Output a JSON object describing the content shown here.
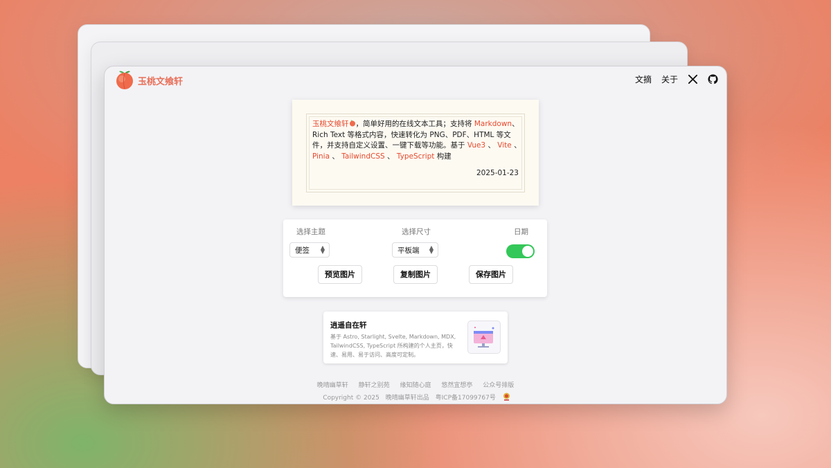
{
  "header": {
    "brand": "玉桃文飨轩",
    "nav": [
      "文摘",
      "关于"
    ],
    "icons": [
      "x-logo-icon",
      "github-icon"
    ]
  },
  "card": {
    "brand": "玉桃文飨轩",
    "text1": "，简单好用的在线文本工具；支持将",
    "markdown": "Markdown",
    "text2": "、Rich Text 等格式内容，快速转化为 PNG、PDF、HTML 等文件，并支持自定义设置、一键下载等功能。基于",
    "tech": [
      "Vue3",
      "Vite",
      "Pinia",
      "TailwindCSS",
      "TypeScript"
    ],
    "sep": "、",
    "end": "构建",
    "date": "2025-01-23"
  },
  "controls": {
    "theme_label": "选择主题",
    "size_label": "选择尺寸",
    "date_label": "日期",
    "theme_value": "便签",
    "size_value": "平板端",
    "date_toggle_on": true,
    "preview_btn": "预览图片",
    "copy_btn": "复制图片",
    "save_btn": "保存图片",
    "toggle_color": "#34c759"
  },
  "promo": {
    "title": "逍遥自在轩",
    "desc": "基于 Astro, Starlight, Svelte, Markdown, MDX, TailwindCSS, TypeScript 所构建的个人主页，快速、易用、易于访问、高度可定制。"
  },
  "footer": {
    "links": [
      "晚晴幽草轩",
      "静轩之别苑",
      "缘知随心庭",
      "悠然宜想亭",
      "公众号排版"
    ],
    "copyright": "Copyright © 2025",
    "org": "晚晴幽草轩出品",
    "icp": "粤ICP备17099767号"
  },
  "colors": {
    "accent": "#e64a2e",
    "brand": "#e8705a"
  }
}
